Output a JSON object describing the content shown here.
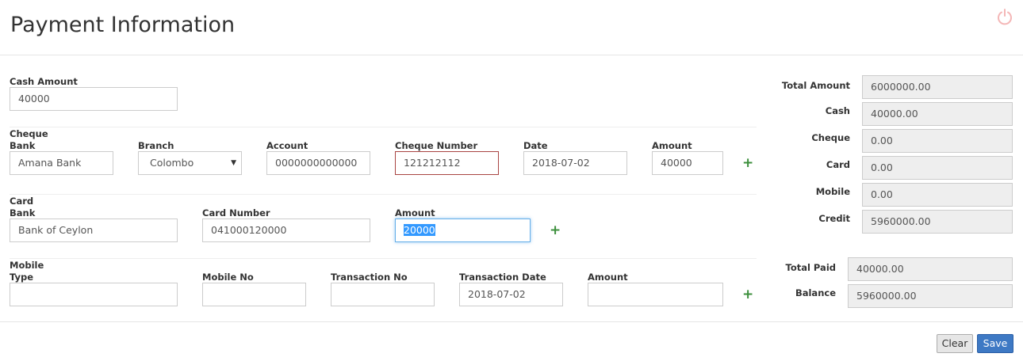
{
  "header": {
    "title": "Payment Information",
    "power_icon": "power-icon"
  },
  "cash": {
    "label": "Cash Amount",
    "value": "40000"
  },
  "cheque": {
    "section_label": "Cheque",
    "bank_label": "Bank",
    "bank_value": "Amana Bank",
    "branch_label": "Branch",
    "branch_value": "Colombo",
    "account_label": "Account",
    "account_value": "0000000000000",
    "number_label": "Cheque Number",
    "number_value": "121212112",
    "date_label": "Date",
    "date_value": "2018-07-02",
    "amount_label": "Amount",
    "amount_value": "40000",
    "add_label": "+"
  },
  "card": {
    "section_label": "Card",
    "bank_label": "Bank",
    "bank_value": "Bank of Ceylon",
    "number_label": "Card Number",
    "number_value": "041000120000",
    "amount_label": "Amount",
    "amount_value": "20000",
    "add_label": "+"
  },
  "mobile": {
    "section_label": "Mobile",
    "type_label": "Type",
    "type_value": "",
    "mobile_no_label": "Mobile No",
    "mobile_no_value": "",
    "transaction_no_label": "Transaction No",
    "transaction_no_value": "",
    "transaction_date_label": "Transaction Date",
    "transaction_date_value": "2018-07-02",
    "amount_label": "Amount",
    "amount_value": "",
    "add_label": "+"
  },
  "summary": {
    "total_amount_label": "Total Amount",
    "total_amount_value": "6000000.00",
    "cash_label": "Cash",
    "cash_value": "40000.00",
    "cheque_label": "Cheque",
    "cheque_value": "0.00",
    "card_label": "Card",
    "card_value": "0.00",
    "mobile_label": "Mobile",
    "mobile_value": "0.00",
    "credit_label": "Credit",
    "credit_value": "5960000.00",
    "total_paid_label": "Total Paid",
    "total_paid_value": "40000.00",
    "balance_label": "Balance",
    "balance_value": "5960000.00"
  },
  "footer": {
    "clear_label": "Clear",
    "save_label": "Save"
  },
  "colors": {
    "accent": "#3e79c4",
    "add": "#3c8f3c",
    "error_border": "#a94442",
    "focus_border": "#66afe9"
  }
}
